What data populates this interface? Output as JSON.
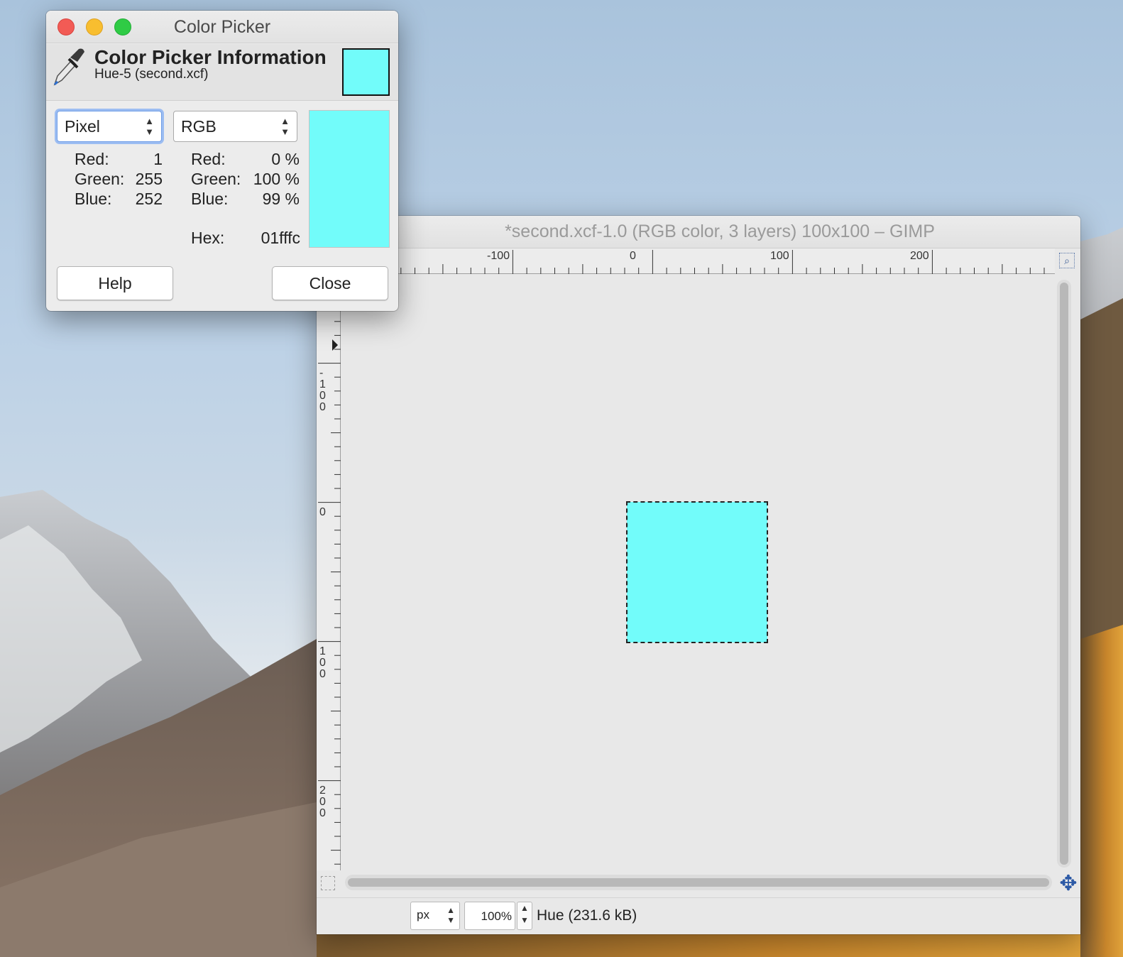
{
  "colors": {
    "picked": "#72fcfa",
    "close_button": "#f25b55",
    "minimize_button": "#f8be2f",
    "maximize_button": "#2fcb45"
  },
  "color_picker": {
    "window_title": "Color Picker",
    "heading": "Color Picker Information",
    "subheading": "Hue-5 (second.xcf)",
    "icon": "eyedropper-icon",
    "left_mode": "Pixel",
    "right_mode": "RGB",
    "pixel_values": [
      {
        "label": "Red:",
        "value": "1"
      },
      {
        "label": "Green:",
        "value": "255"
      },
      {
        "label": "Blue:",
        "value": "252"
      }
    ],
    "rgb_values": [
      {
        "label": "Red:",
        "value": "0 %"
      },
      {
        "label": "Green:",
        "value": "100 %"
      },
      {
        "label": "Blue:",
        "value": "99 %"
      }
    ],
    "hex_label": "Hex:",
    "hex_value": "01fffc",
    "help_label": "Help",
    "close_label": "Close"
  },
  "gimp_window": {
    "title": "*second.xcf-1.0 (RGB color, 3 layers) 100x100 – GIMP",
    "h_ruler_labels": [
      "-100",
      "0",
      "100",
      "200"
    ],
    "v_ruler_labels": [
      "-100",
      "0",
      "100",
      "200"
    ],
    "unit": "px",
    "zoom": "100%",
    "status": "Hue (231.6 kB)"
  }
}
